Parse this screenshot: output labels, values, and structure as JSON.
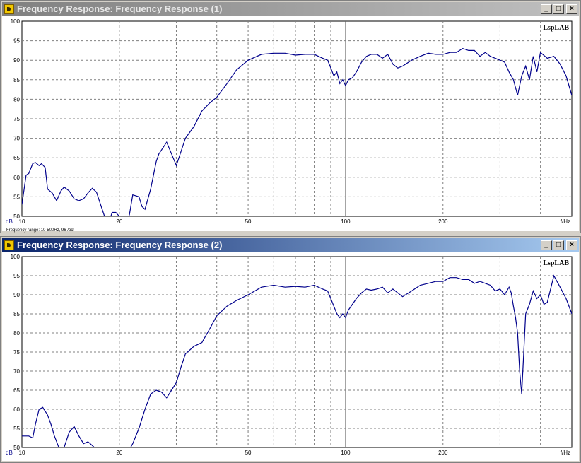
{
  "windows": [
    {
      "title": "Frequency Response: Frequency Response (1)",
      "active": false,
      "brand": "LspLAB",
      "status": "Frequency range: 10-500Hz, 96 /oct"
    },
    {
      "title": "Frequency Response: Frequency Response (2)",
      "active": true,
      "brand": "LspLAB",
      "status": ""
    }
  ],
  "buttons": {
    "minimize": "_",
    "maximize": "□",
    "close": "×"
  },
  "colors": {
    "trace": "#00008b",
    "grid": "#808080",
    "background": "#ffffff",
    "active_title": "#0a246a"
  },
  "chart_data": [
    {
      "type": "line",
      "title": "Frequency Response (1)",
      "xlabel": "f/Hz",
      "ylabel": "dB",
      "xscale": "log",
      "xlim": [
        10,
        500
      ],
      "ylim": [
        50,
        100
      ],
      "x_ticks": [
        "10",
        "20",
        "50",
        "100",
        "200"
      ],
      "y_ticks": [
        "50",
        "55",
        "60",
        "65",
        "70",
        "75",
        "80",
        "85",
        "90",
        "95",
        "100"
      ],
      "grid": true,
      "series": [
        {
          "name": "",
          "x": [
            10,
            10.3,
            10.5,
            10.8,
            11,
            11.3,
            11.5,
            11.8,
            12,
            12.4,
            12.8,
            13.2,
            13.5,
            14,
            14.5,
            15,
            15.5,
            16,
            16.5,
            17,
            17.5,
            18,
            18.5,
            19,
            19.5,
            20,
            20.5,
            21,
            21.5,
            22,
            23,
            23.5,
            24,
            25,
            26,
            26.5,
            27,
            28,
            29,
            30,
            32,
            34,
            36,
            38,
            40,
            43,
            46,
            50,
            55,
            60,
            65,
            70,
            75,
            80,
            85,
            88,
            90,
            92,
            94,
            96,
            98,
            100,
            102,
            105,
            108,
            112,
            116,
            120,
            125,
            130,
            135,
            140,
            145,
            150,
            160,
            170,
            180,
            190,
            200,
            210,
            220,
            230,
            240,
            250,
            260,
            270,
            280,
            290,
            300,
            310,
            320,
            330,
            340,
            350,
            360,
            370,
            380,
            390,
            400,
            420,
            440,
            460,
            480,
            500
          ],
          "values": [
            53,
            60.5,
            61,
            63.5,
            63.8,
            63,
            63.5,
            62.5,
            57,
            56,
            54,
            56.5,
            57.5,
            56.5,
            54.5,
            54,
            54.5,
            56,
            57.2,
            56.2,
            53,
            50,
            48,
            51,
            51,
            50,
            50,
            48,
            50.5,
            55.5,
            55,
            52.5,
            51.8,
            57,
            64,
            66,
            67,
            69,
            66,
            63,
            70,
            73,
            77,
            79,
            80.5,
            84,
            87.5,
            90,
            91.5,
            91.8,
            91.8,
            91.3,
            91.5,
            91.5,
            90.5,
            90,
            88,
            86,
            87,
            84,
            85,
            83.5,
            85,
            85.5,
            87,
            89.5,
            91,
            91.5,
            91.5,
            90.5,
            91.5,
            89,
            88,
            88.5,
            90,
            91,
            91.8,
            91.5,
            91.5,
            92,
            92,
            93,
            92.5,
            92.5,
            91,
            92,
            91,
            90.5,
            90,
            89.5,
            87,
            85,
            81,
            86,
            88.5,
            85,
            91,
            87,
            92,
            90.5,
            91,
            89,
            86,
            81
          ]
        }
      ]
    },
    {
      "type": "line",
      "title": "Frequency Response (2)",
      "xlabel": "f/Hz",
      "ylabel": "dB",
      "xscale": "log",
      "xlim": [
        10,
        500
      ],
      "ylim": [
        50,
        100
      ],
      "x_ticks": [
        "10",
        "20",
        "50",
        "100",
        "200"
      ],
      "y_ticks": [
        "50",
        "55",
        "60",
        "65",
        "70",
        "75",
        "80",
        "85",
        "90",
        "95",
        "100"
      ],
      "grid": true,
      "series": [
        {
          "name": "",
          "x": [
            10,
            10.5,
            10.8,
            11,
            11.3,
            11.6,
            12,
            12.3,
            12.6,
            13,
            13.5,
            14,
            14.5,
            15,
            15.5,
            16,
            16.5,
            17,
            18,
            19,
            19.5,
            20,
            20.5,
            21,
            21.5,
            22,
            23,
            24,
            25,
            26,
            27,
            28,
            29,
            30,
            31,
            32,
            34,
            36,
            38,
            40,
            43,
            46,
            50,
            55,
            60,
            65,
            70,
            75,
            80,
            85,
            88,
            90,
            92,
            94,
            96,
            98,
            100,
            102,
            105,
            108,
            112,
            116,
            120,
            125,
            130,
            135,
            140,
            150,
            160,
            170,
            180,
            190,
            200,
            210,
            220,
            230,
            240,
            250,
            260,
            270,
            280,
            290,
            300,
            310,
            320,
            325,
            330,
            335,
            340,
            345,
            350,
            360,
            370,
            380,
            390,
            400,
            410,
            420,
            440,
            460,
            480,
            500
          ],
          "values": [
            53,
            53,
            52.5,
            56,
            60,
            60.5,
            58.5,
            56,
            53,
            50,
            50,
            54,
            55.5,
            53,
            51,
            51.5,
            50.5,
            49.5,
            48,
            48,
            48,
            50,
            50,
            49.5,
            49.5,
            51,
            55,
            60,
            64,
            65,
            64.5,
            63,
            65,
            67,
            71,
            74.5,
            76.5,
            77.5,
            81,
            84.5,
            87,
            88.5,
            90,
            92,
            92.5,
            92,
            92.2,
            92,
            92.5,
            91.5,
            91,
            89,
            87,
            85,
            84,
            85,
            84,
            86,
            87.5,
            89,
            90.5,
            91.5,
            91.2,
            91.5,
            92,
            90.5,
            91.5,
            89.5,
            91,
            92.5,
            93,
            93.5,
            93.5,
            94.5,
            94.5,
            94,
            94,
            93,
            93.5,
            93,
            92.5,
            91,
            91.5,
            90,
            92,
            90.5,
            87,
            84,
            80,
            70,
            64,
            85,
            87.5,
            91,
            89,
            90,
            87.5,
            88,
            95,
            92,
            89,
            85
          ]
        }
      ]
    }
  ]
}
